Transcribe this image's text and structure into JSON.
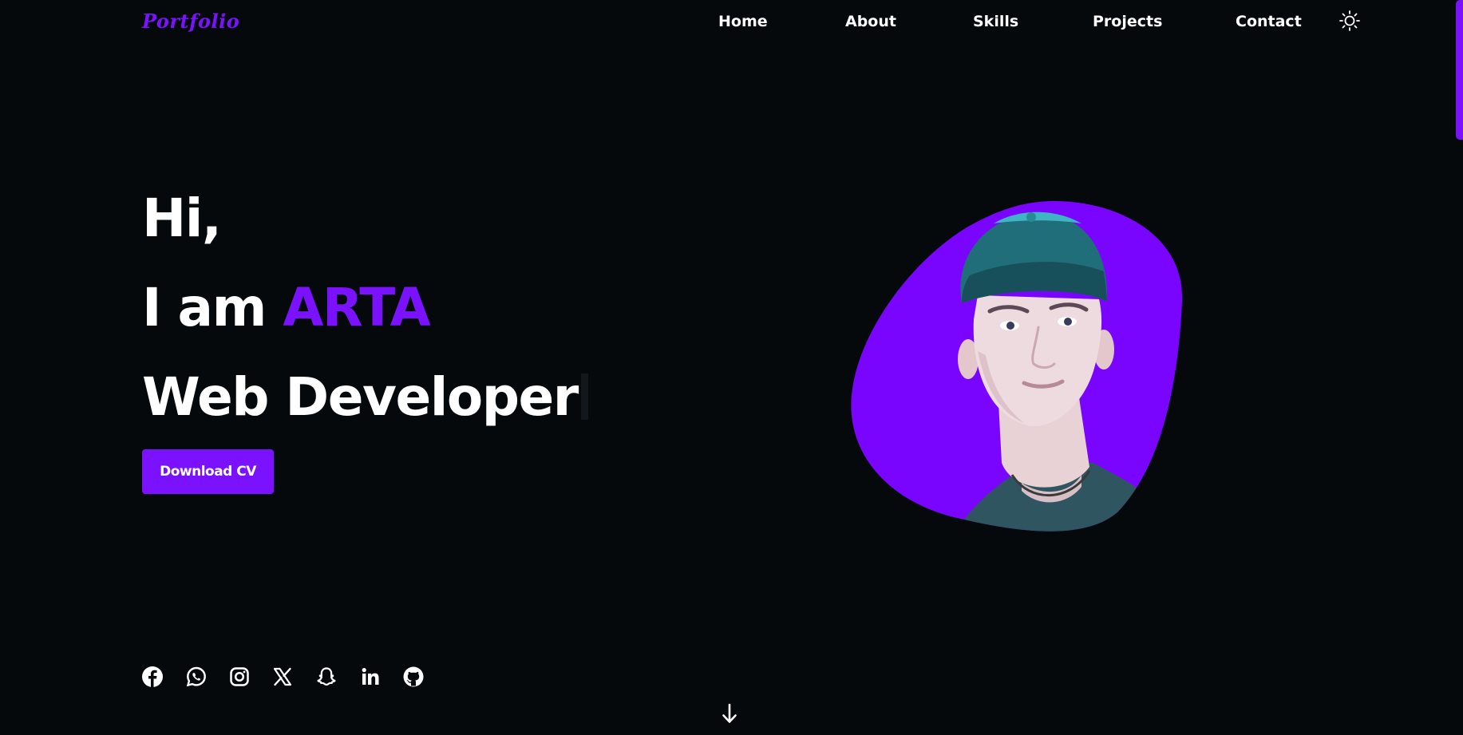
{
  "nav": {
    "logo": "Portfolio",
    "links": [
      "Home",
      "About",
      "Skills",
      "Projects",
      "Contact"
    ],
    "theme_toggle_icon": "sun-icon"
  },
  "hero": {
    "greeting": "Hi,",
    "intro_prefix": "I am",
    "name": "ARTA",
    "role": "Web Developer",
    "cta_label": "Download CV",
    "accent_color": "#7a12ff"
  },
  "socials": [
    {
      "icon": "facebook-icon"
    },
    {
      "icon": "whatsapp-icon"
    },
    {
      "icon": "instagram-icon"
    },
    {
      "icon": "x-twitter-icon"
    },
    {
      "icon": "snapchat-icon"
    },
    {
      "icon": "linkedin-icon"
    },
    {
      "icon": "github-icon"
    }
  ],
  "scroll_indicator_icon": "arrow-down-icon"
}
